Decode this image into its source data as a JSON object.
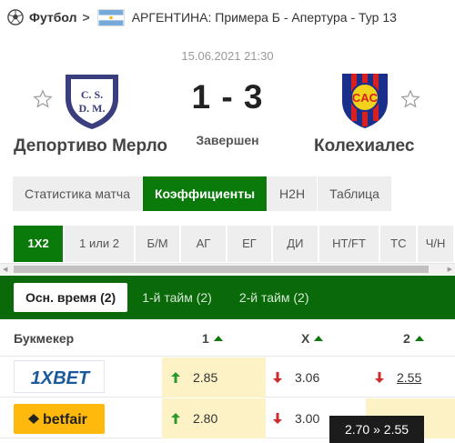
{
  "breadcrumb": {
    "sport": "Футбол",
    "separator": ">",
    "league": "АРГЕНТИНА: Примера Б - Апертура - Тур 13"
  },
  "match": {
    "datetime": "15.06.2021 21:30",
    "score": "1 - 3",
    "status": "Завершен",
    "home_team": "Депортиво Мерло",
    "away_team": "Колехиалес",
    "home_crest_text": "C. S. D. M.",
    "away_crest_text": "CAC"
  },
  "main_tabs": [
    {
      "label": "Статистика матча",
      "active": false
    },
    {
      "label": "Коэффициенты",
      "active": true
    },
    {
      "label": "H2H",
      "active": false
    },
    {
      "label": "Таблица",
      "active": false
    }
  ],
  "market_tabs": [
    {
      "label": "1X2",
      "active": true
    },
    {
      "label": "1 или 2",
      "active": false
    },
    {
      "label": "Б/М",
      "active": false
    },
    {
      "label": "АГ",
      "active": false
    },
    {
      "label": "ЕГ",
      "active": false
    },
    {
      "label": "ДИ",
      "active": false
    },
    {
      "label": "HT/FT",
      "active": false
    },
    {
      "label": "ТС",
      "active": false
    },
    {
      "label": "Ч/Н",
      "active": false
    }
  ],
  "period_tabs": [
    {
      "label": "Осн. время (2)",
      "active": true
    },
    {
      "label": "1-й тайм (2)",
      "active": false
    },
    {
      "label": "2-й тайм (2)",
      "active": false
    }
  ],
  "table": {
    "headers": {
      "bookmaker": "Букмекер",
      "col1": "1",
      "colx": "X",
      "col2": "2"
    },
    "rows": [
      {
        "bookmaker": "1XBET",
        "odds": [
          {
            "value": "2.85",
            "direction": "up",
            "highlight": true
          },
          {
            "value": "3.06",
            "direction": "down",
            "highlight": false
          },
          {
            "value": "2.55",
            "direction": "down",
            "highlight": false
          }
        ]
      },
      {
        "bookmaker": "betfair",
        "odds": [
          {
            "value": "2.80",
            "direction": "up",
            "highlight": true
          },
          {
            "value": "3.00",
            "direction": "down",
            "highlight": false
          },
          {
            "value": "",
            "direction": "",
            "highlight": true
          }
        ]
      }
    ]
  },
  "tooltip": "2.70 » 2.55",
  "colors": {
    "accent_green": "#0a7a0a",
    "arrow_up": "#2a9a2a",
    "arrow_down": "#d02a2a",
    "highlight": "#fdf2c6"
  },
  "icons": [
    "soccer-ball-icon",
    "argentina-flag-icon",
    "star-icon",
    "sort-triangle-icon",
    "arrow-up-icon",
    "arrow-down-icon"
  ]
}
